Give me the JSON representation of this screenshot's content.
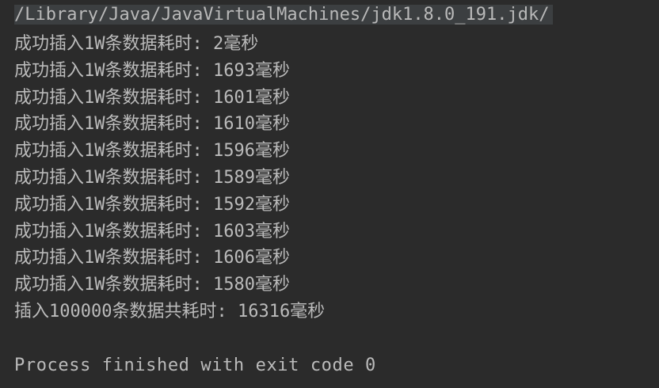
{
  "console": {
    "command": "/Library/Java/JavaVirtualMachines/jdk1.8.0_191.jdk/",
    "lines": [
      "成功插入1W条数据耗时: 2毫秒",
      "成功插入1W条数据耗时: 1693毫秒",
      "成功插入1W条数据耗时: 1601毫秒",
      "成功插入1W条数据耗时: 1610毫秒",
      "成功插入1W条数据耗时: 1596毫秒",
      "成功插入1W条数据耗时: 1589毫秒",
      "成功插入1W条数据耗时: 1592毫秒",
      "成功插入1W条数据耗时: 1603毫秒",
      "成功插入1W条数据耗时: 1606毫秒",
      "成功插入1W条数据耗时: 1580毫秒",
      "插入100000条数据共耗时: 16316毫秒"
    ],
    "exit_message": "Process finished with exit code 0"
  },
  "colors": {
    "background": "#2b2b2b",
    "text": "#bbbbbb",
    "command_highlight": "#3c3f41"
  }
}
